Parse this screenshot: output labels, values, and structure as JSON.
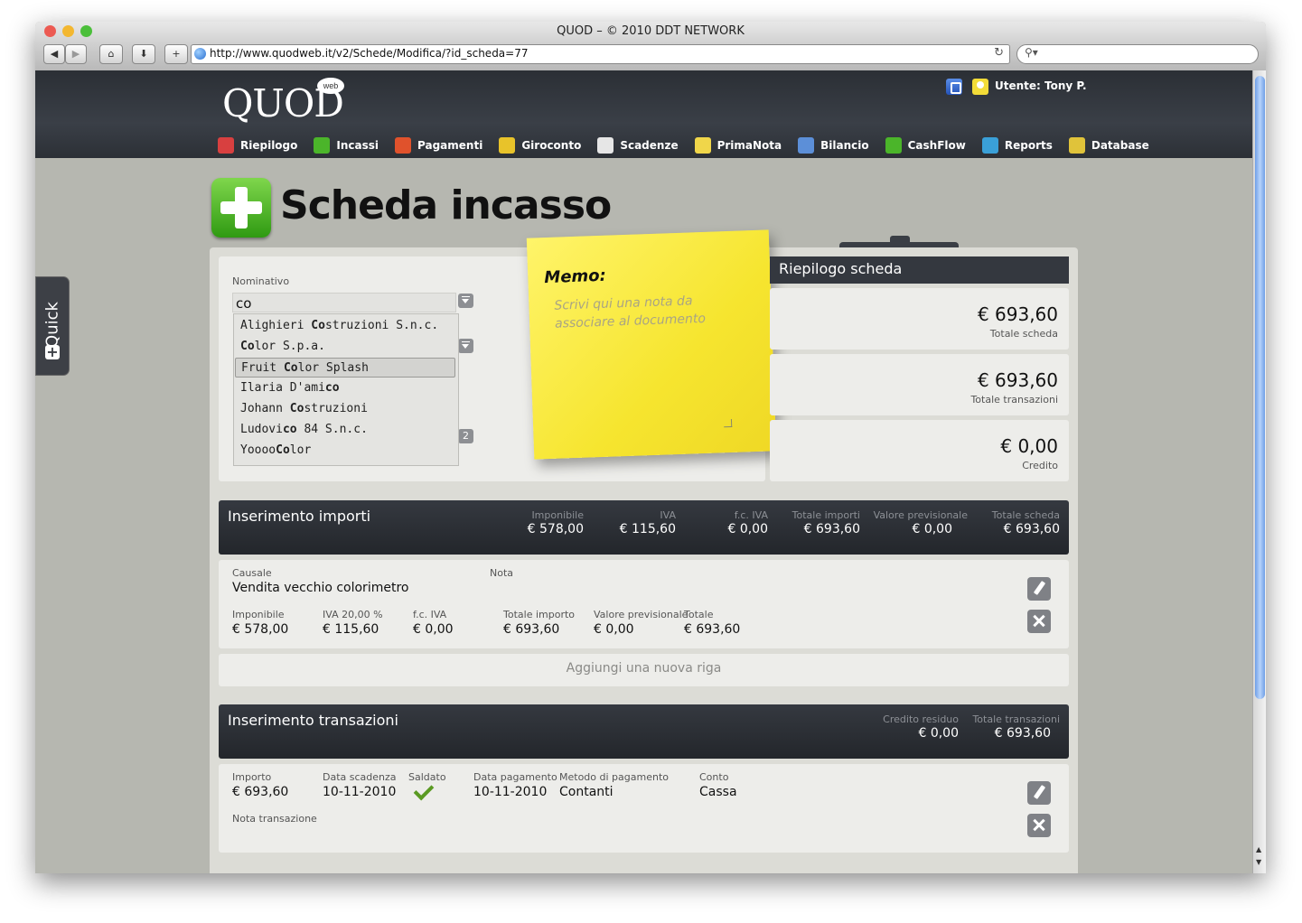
{
  "window": {
    "title": "QUOD – © 2010 DDT NETWORK",
    "url": "http://www.quodweb.it/v2/Schede/Modifica/?id_scheda=77",
    "traffic_colors": [
      "#ec5a52",
      "#f3b730",
      "#4bbf3a"
    ]
  },
  "header": {
    "logo_text": "QUOD",
    "logo_badge": "web",
    "user_label": "Utente: Tony P.",
    "nav": [
      {
        "label": "Riepilogo",
        "icon": "riepilogo-icon",
        "color": "#d84040"
      },
      {
        "label": "Incassi",
        "icon": "incassi-plus-icon",
        "color": "#4bb52a"
      },
      {
        "label": "Pagamenti",
        "icon": "pagamenti-minus-icon",
        "color": "#e0522c"
      },
      {
        "label": "Giroconto",
        "icon": "giroconto-icon",
        "color": "#e8c32a"
      },
      {
        "label": "Scadenze",
        "icon": "calendar-icon",
        "color": "#e6e6e6"
      },
      {
        "label": "PrimaNota",
        "icon": "note-icon",
        "color": "#f0d64a"
      },
      {
        "label": "Bilancio",
        "icon": "bilancio-icon",
        "color": "#5c8fd8"
      },
      {
        "label": "CashFlow",
        "icon": "chart-icon",
        "color": "#4bb52a"
      },
      {
        "label": "Reports",
        "icon": "reports-icon",
        "color": "#3aa0d8"
      },
      {
        "label": "Database",
        "icon": "database-icon",
        "color": "#e0c33a"
      }
    ]
  },
  "quick": {
    "label": "Quick"
  },
  "page": {
    "title": "Scheda incasso"
  },
  "nominativo": {
    "label": "Nominativo",
    "value": "co",
    "suggestions": [
      {
        "pre": "Alighieri ",
        "match": "Co",
        "post": "struzioni S.n.c."
      },
      {
        "pre": "",
        "match": "Co",
        "post": "lor S.p.a."
      },
      {
        "pre": "Fruit ",
        "match": "Co",
        "post": "lor Splash"
      },
      {
        "pre": "Ilaria D'ami",
        "match": "co",
        "post": ""
      },
      {
        "pre": "Johann ",
        "match": "Co",
        "post": "struzioni"
      },
      {
        "pre": "Ludovi",
        "match": "co",
        "post": " 84 S.n.c."
      },
      {
        "pre": "Yoooo",
        "match": "Co",
        "post": "lor"
      }
    ],
    "selected_index": 2,
    "calendar_badge": "2"
  },
  "memo": {
    "title": "Memo:",
    "placeholder": "Scrivi qui una nota da associare al documento"
  },
  "riepilogo": {
    "title": "Riepilogo scheda",
    "cards": [
      {
        "value": "€ 693,60",
        "label": "Totale scheda"
      },
      {
        "value": "€ 693,60",
        "label": "Totale transazioni"
      },
      {
        "value": "€ 0,00",
        "label": "Credito"
      }
    ]
  },
  "importi": {
    "title": "Inserimento importi",
    "totals": [
      {
        "label": "Imponibile",
        "value": "€ 578,00"
      },
      {
        "label": "IVA",
        "value": "€ 115,60"
      },
      {
        "label": "f.c. IVA",
        "value": "€ 0,00"
      },
      {
        "label": "Totale importi",
        "value": "€ 693,60"
      },
      {
        "label": "Valore previsionale",
        "value": "€ 0,00"
      },
      {
        "label": "Totale scheda",
        "value": "€ 693,60"
      }
    ],
    "row": {
      "causale_label": "Causale",
      "causale": "Vendita vecchio colorimetro",
      "nota_label": "Nota",
      "fields": [
        {
          "label": "Imponibile",
          "value": "€ 578,00"
        },
        {
          "label": "IVA 20,00 %",
          "value": "€ 115,60"
        },
        {
          "label": "f.c. IVA",
          "value": "€ 0,00"
        },
        {
          "label": "Totale importo",
          "value": "€ 693,60"
        },
        {
          "label": "Valore previsionale",
          "value": "€ 0,00"
        },
        {
          "label": "Totale",
          "value": "€ 693,60"
        }
      ]
    },
    "add_row": "Aggiungi una nuova riga"
  },
  "transazioni": {
    "title": "Inserimento transazioni",
    "totals": [
      {
        "label": "Credito residuo",
        "value": "€ 0,00"
      },
      {
        "label": "Totale transazioni",
        "value": "€ 693,60"
      }
    ],
    "row": {
      "importo_label": "Importo",
      "importo": "€ 693,60",
      "scadenza_label": "Data scadenza",
      "scadenza": "10-11-2010",
      "saldato_label": "Saldato",
      "pagamento_label": "Data pagamento",
      "pagamento": "10-11-2010",
      "metodo_label": "Metodo di pagamento",
      "metodo": "Contanti",
      "conto_label": "Conto",
      "conto": "Cassa",
      "nota_label": "Nota transazione"
    }
  }
}
